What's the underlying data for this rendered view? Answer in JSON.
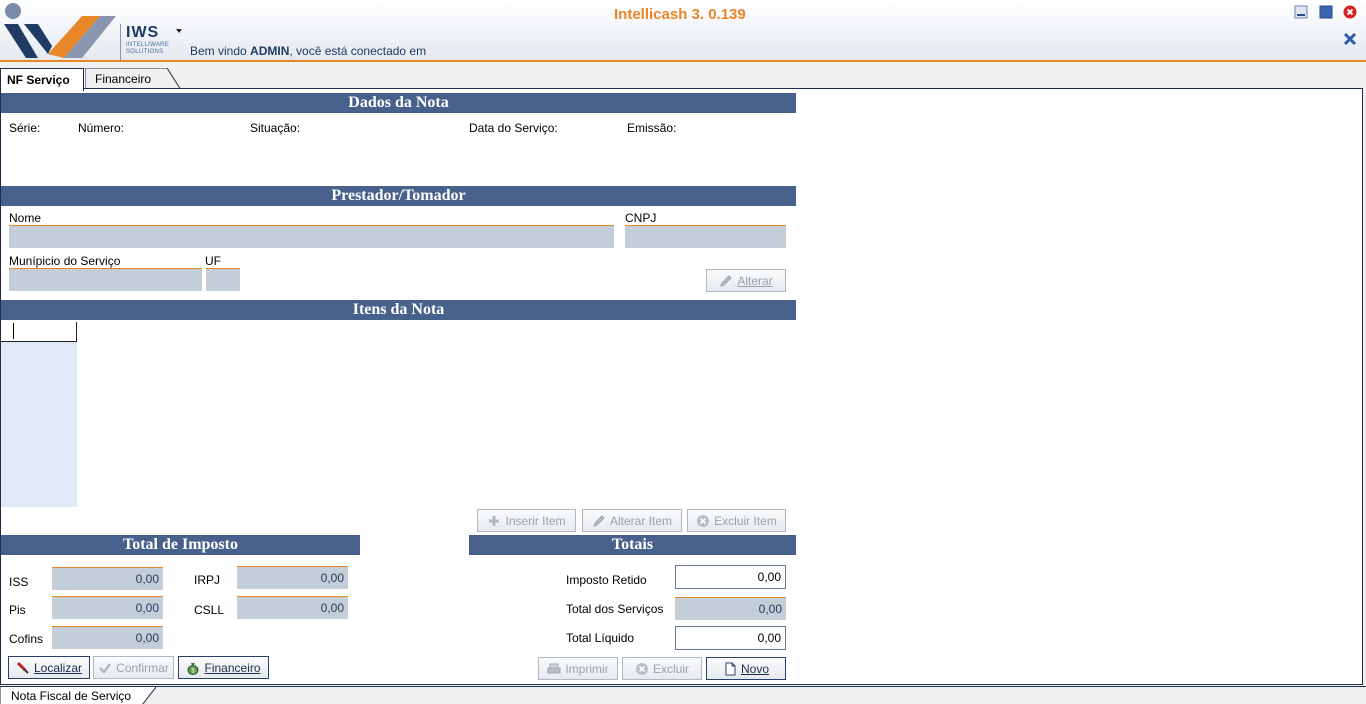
{
  "header": {
    "app_title": "Intellicash 3. 0.139",
    "logo_brand": "IWS",
    "logo_sub": "INTELLIWARE SOLUTIONS",
    "welcome_prefix": "Bem vindo ",
    "welcome_user": "ADMIN",
    "welcome_suffix": ", você está conectado em"
  },
  "tabs": [
    {
      "label": "NF Serviço",
      "active": true
    },
    {
      "label": "Financeiro",
      "active": false
    }
  ],
  "dados_nota": {
    "title": "Dados da Nota",
    "serie_label": "Série:",
    "numero_label": "Número:",
    "situacao_label": "Situação:",
    "data_servico_label": "Data do Serviço:",
    "emissao_label": "Emissão:"
  },
  "prestador": {
    "title": "Prestador/Tomador",
    "nome_label": "Nome",
    "cnpj_label": "CNPJ",
    "municipio_label": "Munípicio do Serviço",
    "uf_label": "UF",
    "alterar_button": "Alterar"
  },
  "itens": {
    "title": "Itens da Nota",
    "inserir_button": "Inserir Item",
    "alterar_button": "Alterar Item",
    "excluir_button": "Excluir Item"
  },
  "total_imposto": {
    "title": "Total de Imposto",
    "iss_label": "ISS",
    "iss_value": "0,00",
    "irpj_label": "IRPJ",
    "irpj_value": "0,00",
    "pis_label": "Pis",
    "pis_value": "0,00",
    "csll_label": "CSLL",
    "csll_value": "0,00",
    "cofins_label": "Cofins",
    "cofins_value": "0,00"
  },
  "totais": {
    "title": "Totais",
    "imposto_retido_label": "Imposto Retido",
    "imposto_retido_value": "0,00",
    "total_servicos_label": "Total dos Serviços",
    "total_servicos_value": "0,00",
    "total_liquido_label": "Total Líquido",
    "total_liquido_value": "0,00"
  },
  "actions": {
    "localizar": "Localizar",
    "confirmar": "Confirmar",
    "financeiro": "Financeiro",
    "imprimir": "Imprimir",
    "excluir": "Excluir",
    "novo": "Novo"
  },
  "statusbar": {
    "tab_label": "Nota Fiscal de Serviço"
  },
  "colors": {
    "section_bar": "#48618c",
    "accent_orange": "#e8862a",
    "field_bg": "#c4ced8"
  }
}
